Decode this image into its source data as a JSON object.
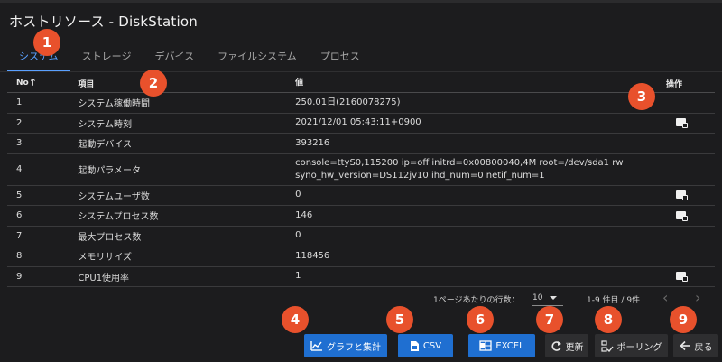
{
  "header": {
    "title": "ホストリソース - DiskStation"
  },
  "tabs": [
    {
      "label": "システム",
      "active": true
    },
    {
      "label": "ストレージ"
    },
    {
      "label": "デバイス"
    },
    {
      "label": "ファイルシステム"
    },
    {
      "label": "プロセス"
    }
  ],
  "table": {
    "columns": {
      "no": "No",
      "item": "項目",
      "value": "値",
      "action": "操作"
    },
    "rows": [
      {
        "no": "1",
        "item": "システム稼働時間",
        "value": "250.01日(2160078275)",
        "has_action": false
      },
      {
        "no": "2",
        "item": "システム時刻",
        "value": "2021/12/01 05:43:11+0900",
        "has_action": true
      },
      {
        "no": "3",
        "item": "起動デバイス",
        "value": "393216",
        "has_action": false
      },
      {
        "no": "4",
        "item": "起動パラメータ",
        "value_line1": "console=ttyS0,115200 ip=off initrd=0x00800040,4M root=/dev/sda1 rw",
        "value_line2": "syno_hw_version=DS112jv10 ihd_num=0 netif_num=1",
        "has_action": false
      },
      {
        "no": "5",
        "item": "システムユーザ数",
        "value": "0",
        "has_action": true
      },
      {
        "no": "6",
        "item": "システムプロセス数",
        "value": "146",
        "has_action": true
      },
      {
        "no": "7",
        "item": "最大プロセス数",
        "value": "0",
        "has_action": false
      },
      {
        "no": "8",
        "item": "メモリサイズ",
        "value": "118456",
        "has_action": false
      },
      {
        "no": "9",
        "item": "CPU1使用率",
        "value": "1",
        "has_action": true
      }
    ]
  },
  "pagination": {
    "rows_per_page_label": "1ページあたりの行数：",
    "rows_per_page": "10",
    "range": "1-9 件目 / 9件"
  },
  "buttons": {
    "graph": "グラフと集計",
    "csv": "CSV",
    "excel": "EXCEL",
    "refresh": "更新",
    "polling": "ポーリング",
    "back": "戻る"
  },
  "callouts": [
    "1",
    "2",
    "3",
    "4",
    "5",
    "6",
    "7",
    "8",
    "9"
  ],
  "colors": {
    "accent": "#5aa0ff",
    "primary_button": "#1f6fd1",
    "callout": "#e8512c",
    "background": "#1c1c1e"
  },
  "icons": [
    "sort-up-icon",
    "chart-edit-icon",
    "chart-icon",
    "csv-file-icon",
    "excel-icon",
    "refresh-icon",
    "polling-icon",
    "back-arrow-icon",
    "chevron-left-icon",
    "chevron-right-icon",
    "dropdown-caret-icon"
  ]
}
